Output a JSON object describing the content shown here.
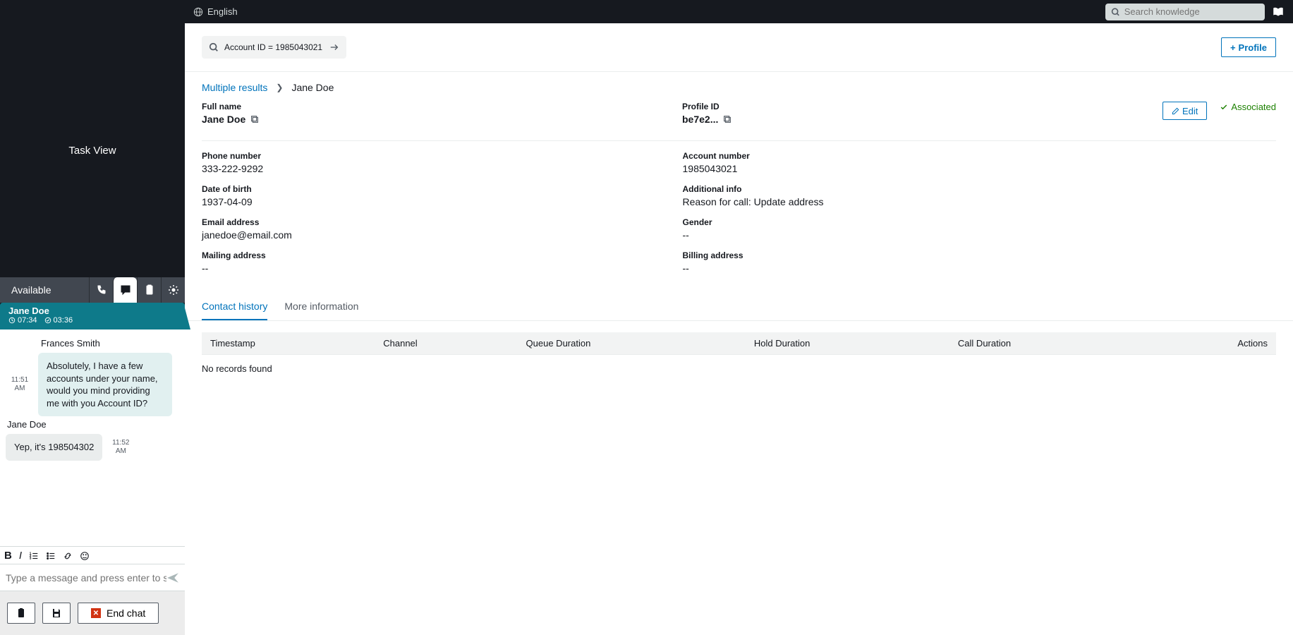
{
  "topbar": {
    "language": "English",
    "search_placeholder": "Search knowledge"
  },
  "sidebar": {
    "task_view_label": "Task View",
    "status": "Available",
    "active_contact": {
      "name": "Jane Doe",
      "timer1": "07:34",
      "timer2": "03:36"
    }
  },
  "chat": {
    "agent_name": "Frances Smith",
    "customer_name": "Jane Doe",
    "messages": [
      {
        "from": "agent",
        "time": "11:51 AM",
        "text": "Absolutely, I have a few accounts under your name, would you mind providing me with you Account ID?"
      },
      {
        "from": "customer",
        "time": "11:52 AM",
        "text": "Yep, it's 198504302"
      }
    ],
    "input_placeholder": "Type a message and press enter to send",
    "end_chat_label": "End chat"
  },
  "search": {
    "query_text": "Account ID = 1985043021",
    "profile_button": "Profile"
  },
  "breadcrumb": {
    "link": "Multiple results",
    "current": "Jane Doe"
  },
  "profile": {
    "full_name_label": "Full name",
    "full_name": "Jane Doe",
    "profile_id_label": "Profile ID",
    "profile_id": "be7e2...",
    "edit_label": "Edit",
    "associated_label": "Associated",
    "phone_label": "Phone number",
    "phone": "333-222-9292",
    "account_label": "Account number",
    "account": "1985043021",
    "dob_label": "Date of birth",
    "dob": "1937-04-09",
    "addl_label": "Additional info",
    "addl": "Reason for call: Update address",
    "email_label": "Email address",
    "email": "janedoe@email.com",
    "gender_label": "Gender",
    "gender": "--",
    "mailing_label": "Mailing address",
    "mailing": "--",
    "billing_label": "Billing address",
    "billing": "--"
  },
  "tabs": {
    "contact_history": "Contact history",
    "more_info": "More information"
  },
  "table": {
    "headers": [
      "Timestamp",
      "Channel",
      "Queue Duration",
      "Hold Duration",
      "Call Duration",
      "Actions"
    ],
    "empty": "No records found"
  }
}
